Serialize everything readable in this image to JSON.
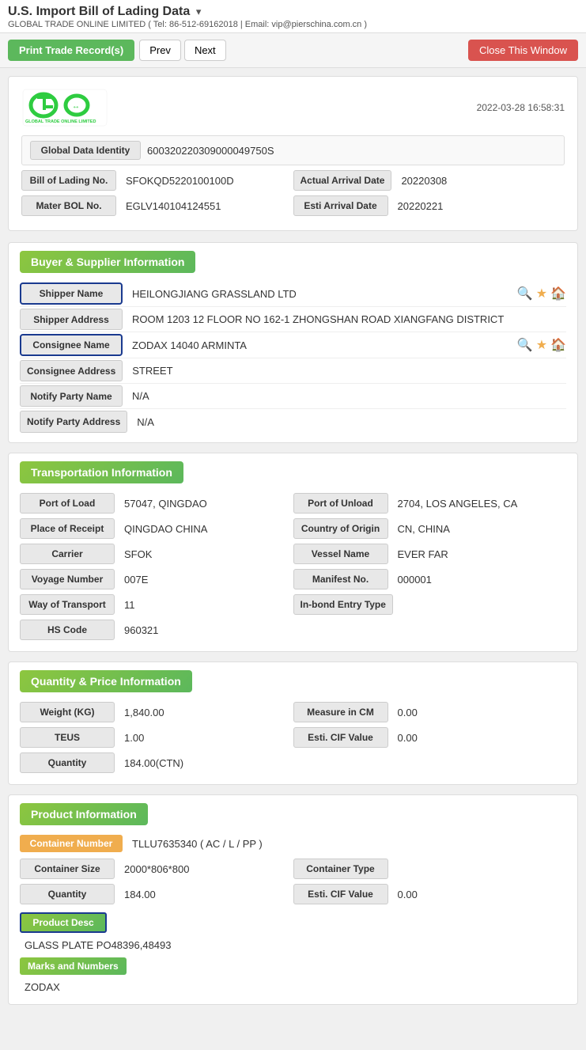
{
  "page": {
    "title": "U.S. Import Bill of Lading Data",
    "arrow": "▾",
    "subtitle": "GLOBAL TRADE ONLINE LIMITED ( Tel: 86-512-69162018 | Email: vip@pierschina.com.cn )"
  },
  "toolbar": {
    "print_label": "Print Trade Record(s)",
    "prev_label": "Prev",
    "next_label": "Next",
    "close_label": "Close This Window"
  },
  "record": {
    "timestamp": "2022-03-28 16:58:31",
    "global_data_identity_label": "Global Data Identity",
    "global_data_identity_value": "600320220309000049750S",
    "bill_of_lading_no_label": "Bill of Lading No.",
    "bill_of_lading_no_value": "SFOKQD5220100100D",
    "actual_arrival_date_label": "Actual Arrival Date",
    "actual_arrival_date_value": "20220308",
    "mater_bol_no_label": "Mater BOL No.",
    "mater_bol_no_value": "EGLV140104124551",
    "esti_arrival_date_label": "Esti Arrival Date",
    "esti_arrival_date_value": "20220221"
  },
  "buyer_supplier": {
    "section_title": "Buyer & Supplier Information",
    "shipper_name_label": "Shipper Name",
    "shipper_name_value": "HEILONGJIANG GRASSLAND LTD",
    "shipper_address_label": "Shipper Address",
    "shipper_address_value": "ROOM 1203 12 FLOOR NO 162-1 ZHONGSHAN ROAD XIANGFANG DISTRICT",
    "consignee_name_label": "Consignee Name",
    "consignee_name_value": "ZODAX 14040 ARMINTA",
    "consignee_address_label": "Consignee Address",
    "consignee_address_value": "STREET",
    "notify_party_name_label": "Notify Party Name",
    "notify_party_name_value": "N/A",
    "notify_party_address_label": "Notify Party Address",
    "notify_party_address_value": "N/A"
  },
  "transportation": {
    "section_title": "Transportation Information",
    "port_of_load_label": "Port of Load",
    "port_of_load_value": "57047, QINGDAO",
    "port_of_unload_label": "Port of Unload",
    "port_of_unload_value": "2704, LOS ANGELES, CA",
    "place_of_receipt_label": "Place of Receipt",
    "place_of_receipt_value": "QINGDAO CHINA",
    "country_of_origin_label": "Country of Origin",
    "country_of_origin_value": "CN, CHINA",
    "carrier_label": "Carrier",
    "carrier_value": "SFOK",
    "vessel_name_label": "Vessel Name",
    "vessel_name_value": "EVER FAR",
    "voyage_number_label": "Voyage Number",
    "voyage_number_value": "007E",
    "manifest_no_label": "Manifest No.",
    "manifest_no_value": "000001",
    "way_of_transport_label": "Way of Transport",
    "way_of_transport_value": "11",
    "in_bond_entry_type_label": "In-bond Entry Type",
    "in_bond_entry_type_value": "",
    "hs_code_label": "HS Code",
    "hs_code_value": "960321"
  },
  "quantity_price": {
    "section_title": "Quantity & Price Information",
    "weight_label": "Weight (KG)",
    "weight_value": "1,840.00",
    "measure_in_cm_label": "Measure in CM",
    "measure_in_cm_value": "0.00",
    "teus_label": "TEUS",
    "teus_value": "1.00",
    "esti_cif_value_label": "Esti. CIF Value",
    "esti_cif_value_value": "0.00",
    "quantity_label": "Quantity",
    "quantity_value": "184.00(CTN)"
  },
  "product": {
    "section_title": "Product Information",
    "container_number_label": "Container Number",
    "container_number_value": "TLLU7635340 ( AC / L / PP )",
    "container_size_label": "Container Size",
    "container_size_value": "2000*806*800",
    "container_type_label": "Container Type",
    "container_type_value": "",
    "quantity_label": "Quantity",
    "quantity_value": "184.00",
    "esti_cif_value_label": "Esti. CIF Value",
    "esti_cif_value_value": "0.00",
    "product_desc_label": "Product Desc",
    "product_desc_value": "GLASS PLATE PO48396,48493",
    "marks_and_numbers_label": "Marks and Numbers",
    "marks_and_numbers_value": "ZODAX"
  },
  "icons": {
    "search": "🔍",
    "star": "★",
    "home": "🏠",
    "dropdown": "▾"
  }
}
